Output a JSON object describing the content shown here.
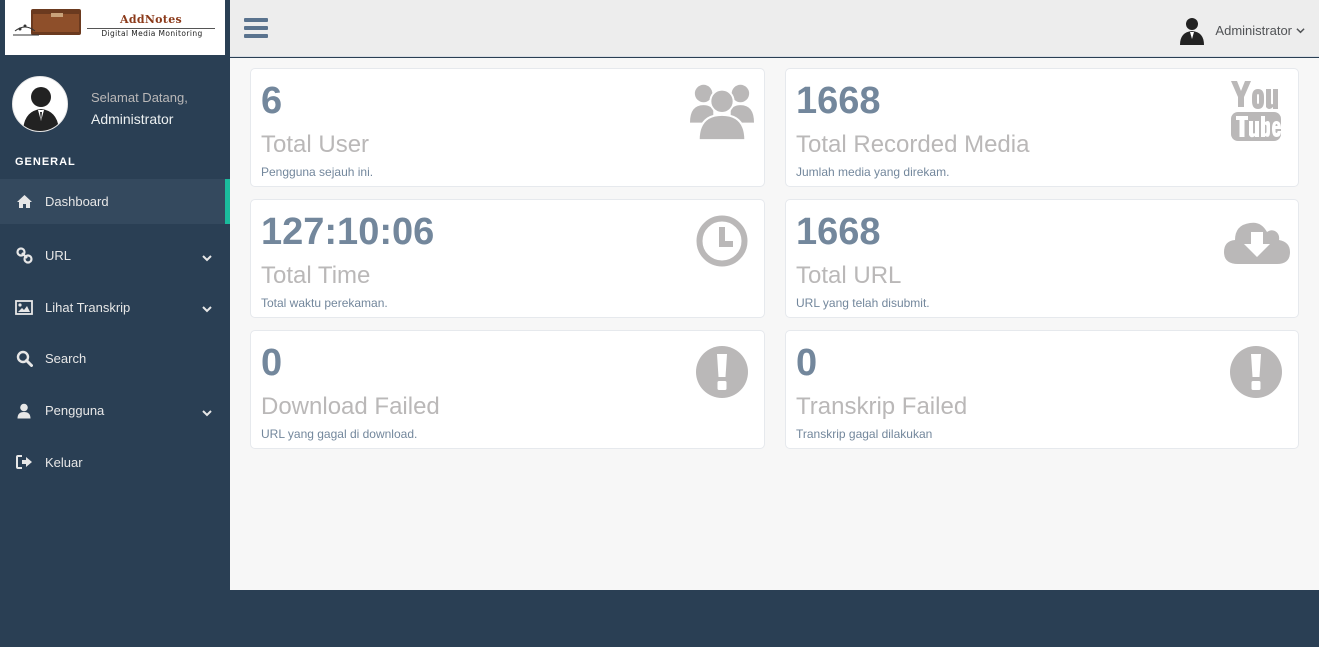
{
  "brand": {
    "title": "AddNotes",
    "subtitle": "Digital Media Monitoring"
  },
  "profile": {
    "welcome": "Selamat Datang,",
    "name": "Administrator"
  },
  "sidebar": {
    "section_title": "GENERAL",
    "items": [
      {
        "label": "Dashboard",
        "icon": "home-icon",
        "active": true
      },
      {
        "label": "URL",
        "icon": "link-icon",
        "has_submenu": true
      },
      {
        "label": "Lihat Transkrip",
        "icon": "image-icon",
        "has_submenu": true
      },
      {
        "label": "Search",
        "icon": "search-icon"
      },
      {
        "label": "Pengguna",
        "icon": "user-icon",
        "has_submenu": true
      },
      {
        "label": "Keluar",
        "icon": "sign-out-icon"
      }
    ]
  },
  "topbar": {
    "user_name": "Administrator"
  },
  "tiles": [
    {
      "count": "6",
      "title": "Total User",
      "desc": "Pengguna sejauh ini.",
      "icon": "users-icon"
    },
    {
      "count": "1668",
      "title": "Total Recorded Media",
      "desc": "Jumlah media yang direkam.",
      "icon": "youtube-icon"
    },
    {
      "count": "127:10:06",
      "title": "Total Time",
      "desc": "Total waktu perekaman.",
      "icon": "clock-icon"
    },
    {
      "count": "1668",
      "title": "Total URL",
      "desc": "URL yang telah disubmit.",
      "icon": "cloud-download-icon"
    },
    {
      "count": "0",
      "title": "Download Failed",
      "desc": "URL yang gagal di download.",
      "icon": "exclamation-icon"
    },
    {
      "count": "0",
      "title": "Transkrip Failed",
      "desc": "Transkrip gagal dilakukan",
      "icon": "exclamation-icon"
    }
  ],
  "colors": {
    "sidebar_bg": "#2a3f54",
    "accent": "#1abb9c",
    "count_text": "#73879c",
    "icon_gray": "#bab8b8"
  }
}
